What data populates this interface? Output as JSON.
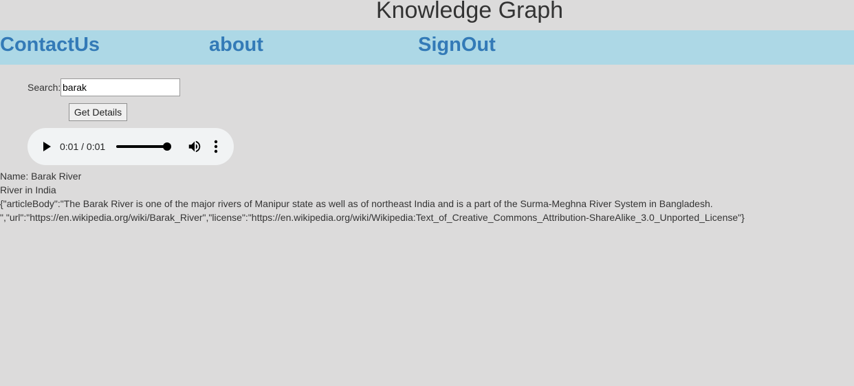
{
  "header": {
    "title": "Knowledge Graph"
  },
  "nav": {
    "items": [
      {
        "label": "ContactUs"
      },
      {
        "label": "about"
      },
      {
        "label": "SignOut"
      }
    ]
  },
  "search": {
    "label": "Search:",
    "value": "barak",
    "button_label": "Get Details"
  },
  "audio": {
    "time": "0:01 / 0:01",
    "progress_fraction": 1.0,
    "icons": {
      "play": "play-icon",
      "volume": "volume-icon",
      "menu": "more-vertical-icon"
    }
  },
  "result": {
    "name_line": "Name: Barak River",
    "description": "River in India",
    "detail_line_1": "{\"articleBody\":\"The Barak River is one of the major rivers of Manipur state as well as of northeast India and is a part of the Surma-Meghna River System in Bangladesh.",
    "detail_line_2": "\",\"url\":\"https://en.wikipedia.org/wiki/Barak_River\",\"license\":\"https://en.wikipedia.org/wiki/Wikipedia:Text_of_Creative_Commons_Attribution-ShareAlike_3.0_Unported_License\"}"
  },
  "colors": {
    "background": "#dcdbdb",
    "navbar": "#add8e6",
    "nav_link": "#337ab7",
    "text": "#333333"
  }
}
